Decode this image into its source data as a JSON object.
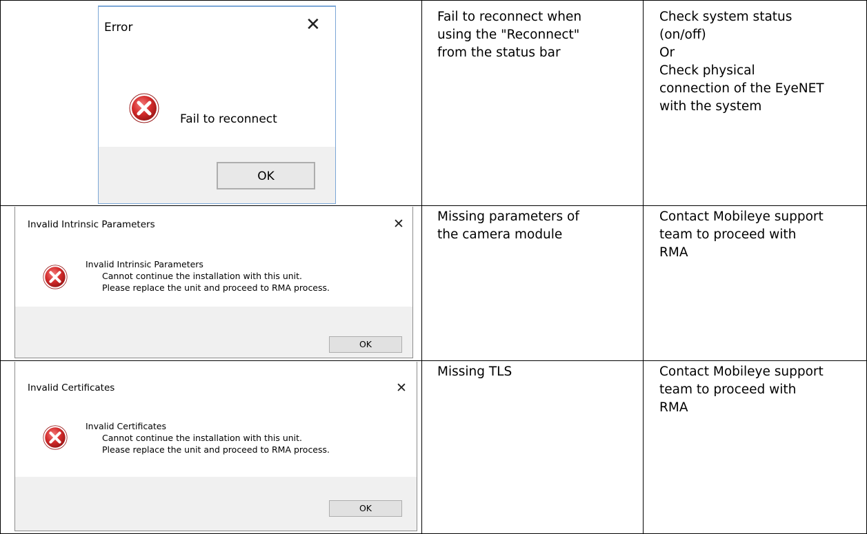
{
  "rows": [
    {
      "dialog": {
        "title": "Error",
        "message_lines": [
          "Fail to reconnect"
        ],
        "ok_label": "OK",
        "icon": "error-x-icon",
        "close_icon": "close-icon"
      },
      "description": [
        "Fail to reconnect when",
        "using the \"Reconnect\"",
        "from the status bar"
      ],
      "action": [
        "Check system status",
        "(on/off)",
        "Or",
        "Check physical",
        "connection of the EyeNET",
        "with the system"
      ]
    },
    {
      "dialog": {
        "title": "Invalid Intrinsic Parameters",
        "message_lines": [
          "Invalid Intrinsic Parameters",
          "Cannot continue the installation with this unit.",
          "Please replace the unit and proceed to RMA process."
        ],
        "ok_label": "OK",
        "icon": "error-x-icon",
        "close_icon": "close-icon"
      },
      "description": [
        "Missing parameters of",
        "the camera module"
      ],
      "action": [
        "Contact Mobileye support",
        "team to proceed with",
        "RMA"
      ]
    },
    {
      "dialog": {
        "title": "Invalid Certificates",
        "message_lines": [
          "Invalid Certificates",
          "Cannot continue the installation with this unit.",
          "Please replace the unit and proceed to RMA process."
        ],
        "ok_label": "OK",
        "icon": "error-x-icon",
        "close_icon": "close-icon"
      },
      "description": [
        "Missing TLS"
      ],
      "action": [
        "Contact Mobileye support",
        "team to proceed with",
        "RMA"
      ]
    }
  ],
  "colors": {
    "dialog_footer": "#f0f0f0",
    "error_red": "#c8262b",
    "dialog_border": "#7aa6d6"
  }
}
